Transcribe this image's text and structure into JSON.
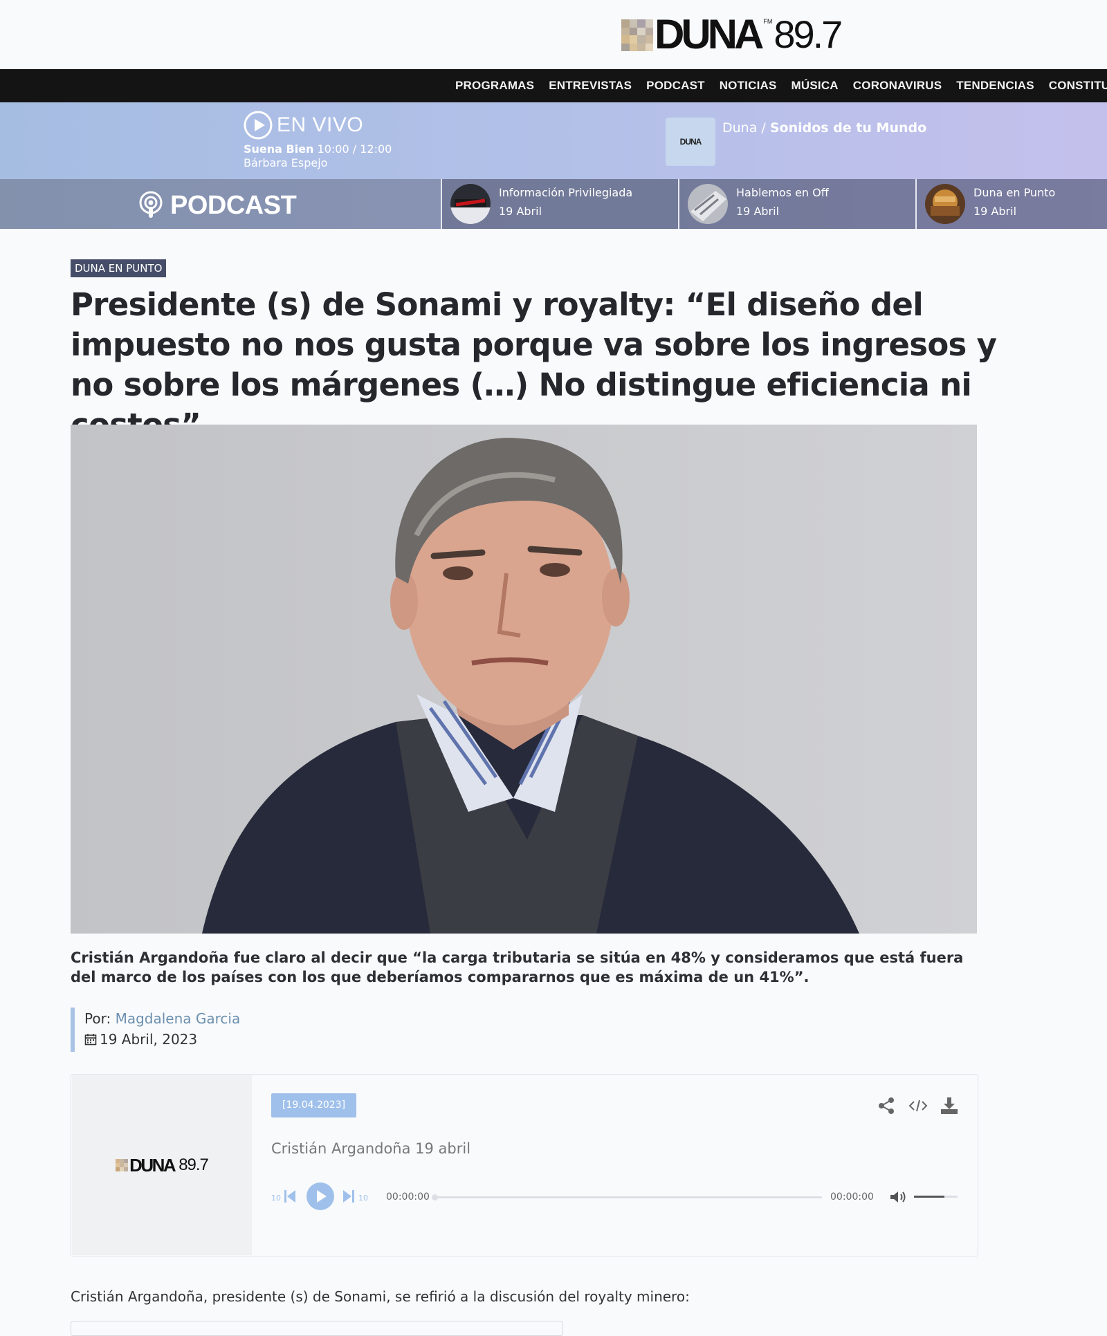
{
  "header": {
    "logo_word": "DUNA",
    "logo_fm": "FM",
    "logo_frequency": "89.7"
  },
  "nav": {
    "items": [
      "PROGRAMAS",
      "ENTREVISTAS",
      "PODCAST",
      "NOTICIAS",
      "MÚSICA",
      "CORONAVIRUS",
      "TENDENCIAS",
      "CONSTITUCIÓN"
    ]
  },
  "live": {
    "label": "EN VIVO",
    "show_name": "Suena Bien",
    "show_time": "10:00 / 12:00",
    "host": "Bárbara Espejo",
    "thumb_text": "DUNA",
    "now_station": "Duna /",
    "now_program": "Sonidos de tu Mundo"
  },
  "podcast_strip": {
    "label": "PODCAST",
    "items": [
      {
        "title": "Información Privilegiada",
        "date": "19 Abril"
      },
      {
        "title": "Hablemos en Off",
        "date": "19 Abril"
      },
      {
        "title": "Duna en Punto",
        "date": "19 Abril"
      }
    ]
  },
  "article": {
    "category": "DUNA EN PUNTO",
    "headline": "Presidente (s) de Sonami y royalty: “El diseño del impuesto no nos gusta porque va sobre los ingresos y no sobre los márgenes (…) No distingue eficiencia ni costos”",
    "caption": "Cristián Argandoña fue claro al decir que “la carga tributaria se sitúa en 48% y consideramos que está fuera del marco de los países con los que deberíamos compararnos que es máxima de un 41%”.",
    "author_prefix": "Por:",
    "author": "Magdalena Garcia",
    "date": "19 Abril, 2023",
    "body_first": "Cristián Argandoña, presidente (s) de Sonami, se refirió a la discusión del royalty minero:"
  },
  "player": {
    "logo_word": "DUNA",
    "logo_freq": "89.7",
    "episode_date": "[19.04.2023]",
    "episode_title": "Cristián Argandoña 19 abril",
    "skip_back": "10",
    "skip_forward": "10",
    "time_current": "00:00:00",
    "time_total": "00:00:00",
    "progress": 0,
    "volume": 0.7
  },
  "colors": {
    "nav_bg": "#141414",
    "category_bg": "#454d68",
    "accent_blue": "#9fc0ea",
    "author_link": "#6b8fae"
  }
}
